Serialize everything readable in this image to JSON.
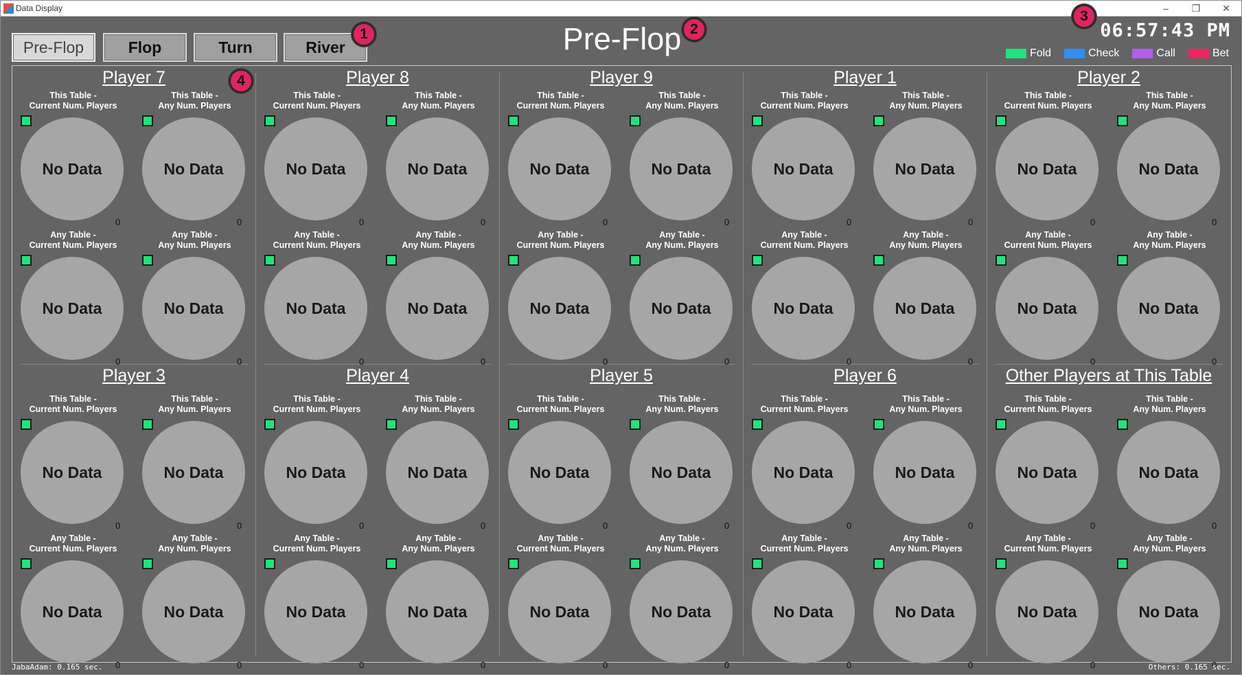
{
  "window": {
    "title": "Data Display",
    "min": "–",
    "restore": "❐",
    "close": "✕"
  },
  "streets": [
    {
      "label": "Pre-Flop",
      "active": true
    },
    {
      "label": "Flop",
      "active": false
    },
    {
      "label": "Turn",
      "active": false
    },
    {
      "label": "River",
      "active": false
    }
  ],
  "header": {
    "title": "Pre-Flop",
    "clock": "06:57:43 PM"
  },
  "legend": [
    {
      "label": "Fold",
      "color": "#1ee57b"
    },
    {
      "label": "Check",
      "color": "#2f8ff7"
    },
    {
      "label": "Call",
      "color": "#b65cf0"
    },
    {
      "label": "Bet",
      "color": "#f0245e"
    }
  ],
  "badges": [
    "1",
    "2",
    "3",
    "4"
  ],
  "stat_captions": [
    "This Table -\nCurrent Num. Players",
    "This Table -\nAny Num. Players",
    "Any Table -\nCurrent Num. Players",
    "Any Table -\nAny Num. Players"
  ],
  "no_data_text": "No Data",
  "count_value": "0",
  "players": [
    "Player 7",
    "Player 8",
    "Player 9",
    "Player 1",
    "Player 2",
    "Player 3",
    "Player 4",
    "Player 5",
    "Player 6",
    "Other Players at This Table"
  ],
  "footer": {
    "left": "JabaAdam: 0.165 sec.",
    "right": "Others: 0.165 sec."
  }
}
